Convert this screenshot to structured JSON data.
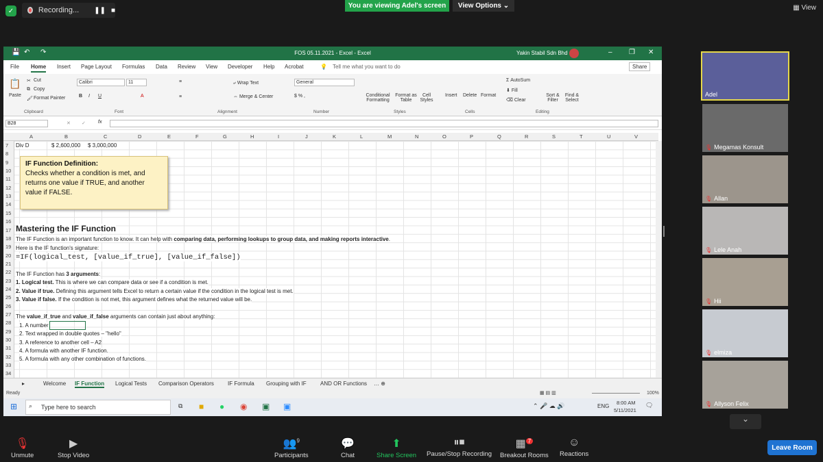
{
  "zoom": {
    "recording": "Recording...",
    "viewing": "You are viewing Adel's screen",
    "view_options": "View Options ⌄",
    "view": "View"
  },
  "excel": {
    "title": "FOS 05.11.2021 - Excel - Excel",
    "user": "Yakin Stabil Sdn Bhd",
    "menu": [
      "File",
      "Home",
      "Insert",
      "Page Layout",
      "Formulas",
      "Data",
      "Review",
      "View",
      "Developer",
      "Help",
      "Acrobat"
    ],
    "tell_me": "Tell me what you want to do",
    "share": "Share",
    "ribbon": {
      "paste": "Paste",
      "cut": "Cut",
      "copy": "Copy",
      "format_painter": "Format Painter",
      "font": "Calibri",
      "size": "11",
      "wrap": "Wrap Text",
      "merge": "Merge & Center",
      "number": "General",
      "cond": "Conditional Formatting",
      "fmt_table": "Format as Table",
      "cell_styles": "Cell Styles",
      "insert": "Insert",
      "delete": "Delete",
      "format": "Format",
      "autosum": "AutoSum",
      "fill": "Fill",
      "clear": "Clear",
      "sort": "Sort & Filter",
      "find": "Find & Select",
      "groups": [
        "Clipboard",
        "Font",
        "Alignment",
        "Number",
        "Styles",
        "Cells",
        "Editing"
      ]
    },
    "namebox": "B28",
    "columns": [
      "A",
      "B",
      "C",
      "D",
      "E",
      "F",
      "G",
      "H",
      "I",
      "J",
      "K",
      "L",
      "M",
      "N",
      "O",
      "P",
      "Q",
      "R",
      "S",
      "T",
      "U",
      "V"
    ],
    "rows": [
      "7",
      "8",
      "9",
      "10",
      "11",
      "12",
      "13",
      "14",
      "15",
      "16",
      "17",
      "18",
      "19",
      "20",
      "21",
      "22",
      "23",
      "24",
      "25",
      "26",
      "27",
      "28",
      "29",
      "30",
      "31",
      "32",
      "33",
      "34"
    ],
    "row7": {
      "a": "Div D",
      "b": "$ 2,600,000",
      "c": "$ 3,000,000"
    },
    "note": {
      "title": "IF Function Definition:",
      "body": "Checks whether a condition is met, and returns one value if TRUE, and another value if FALSE."
    },
    "heading": "Mastering the IF Function",
    "r18a": "The IF Function is an important function to know. It can help with ",
    "r18b": "comparing data, performing lookups to group data, and making reports interactive",
    "r19": "Here is the IF function's signature:",
    "r20": "=IF(logical_test, [value_if_true], [value_if_false])",
    "r22a": "The IF Function has ",
    "r22b": "3 arguments",
    "r23a": "1. Logical test.",
    "r23b": " This is where we can compare data or see if a condition is met.",
    "r24a": "2. Value if true.",
    "r24b": " Defining this argument tells Excel to return a certain value if the condition in the logical test is met.",
    "r25a": "3. Value if false.",
    "r25b": " If the condition is not met, this argument defines what the returned value will be.",
    "r27a": "The ",
    "r27b": "value_if_true",
    "r27c": " and ",
    "r27d": "value_if_false",
    "r27e": " arguments can contain just about anything:",
    "list": [
      "1. A number",
      "2. Text wrapped in double quotes – \"hello\"",
      "3. A reference to another cell – A2",
      "4. A formula with another IF function.",
      "5. A formula with any other combination of functions."
    ],
    "tabs": [
      "Welcome",
      "IF Function",
      "Logical Tests",
      "Comparison Operators",
      "IF Formula",
      "Grouping with IF",
      "AND OR Functions"
    ],
    "status": "Ready",
    "zoom": "100%",
    "search": "Type here to search",
    "time": "8:00 AM",
    "date": "5/11/2021",
    "lang": "ENG"
  },
  "participants": [
    "Adel",
    "Megamas Konsult",
    "Allan",
    "Lele Anah",
    "Hii",
    "elmiza",
    "Allyson Felix"
  ],
  "bottom": {
    "unmute": "Unmute",
    "stop_video": "Stop Video",
    "participants": "Participants",
    "participants_count": "9",
    "chat": "Chat",
    "share": "Share Screen",
    "pause": "Pause/Stop Recording",
    "breakout": "Breakout Rooms",
    "breakout_count": "7",
    "reactions": "Reactions",
    "leave": "Leave Room"
  },
  "colors": {
    "excel_green": "#217346",
    "zoom_green": "#23a34a",
    "leave_blue": "#1f73d2"
  }
}
